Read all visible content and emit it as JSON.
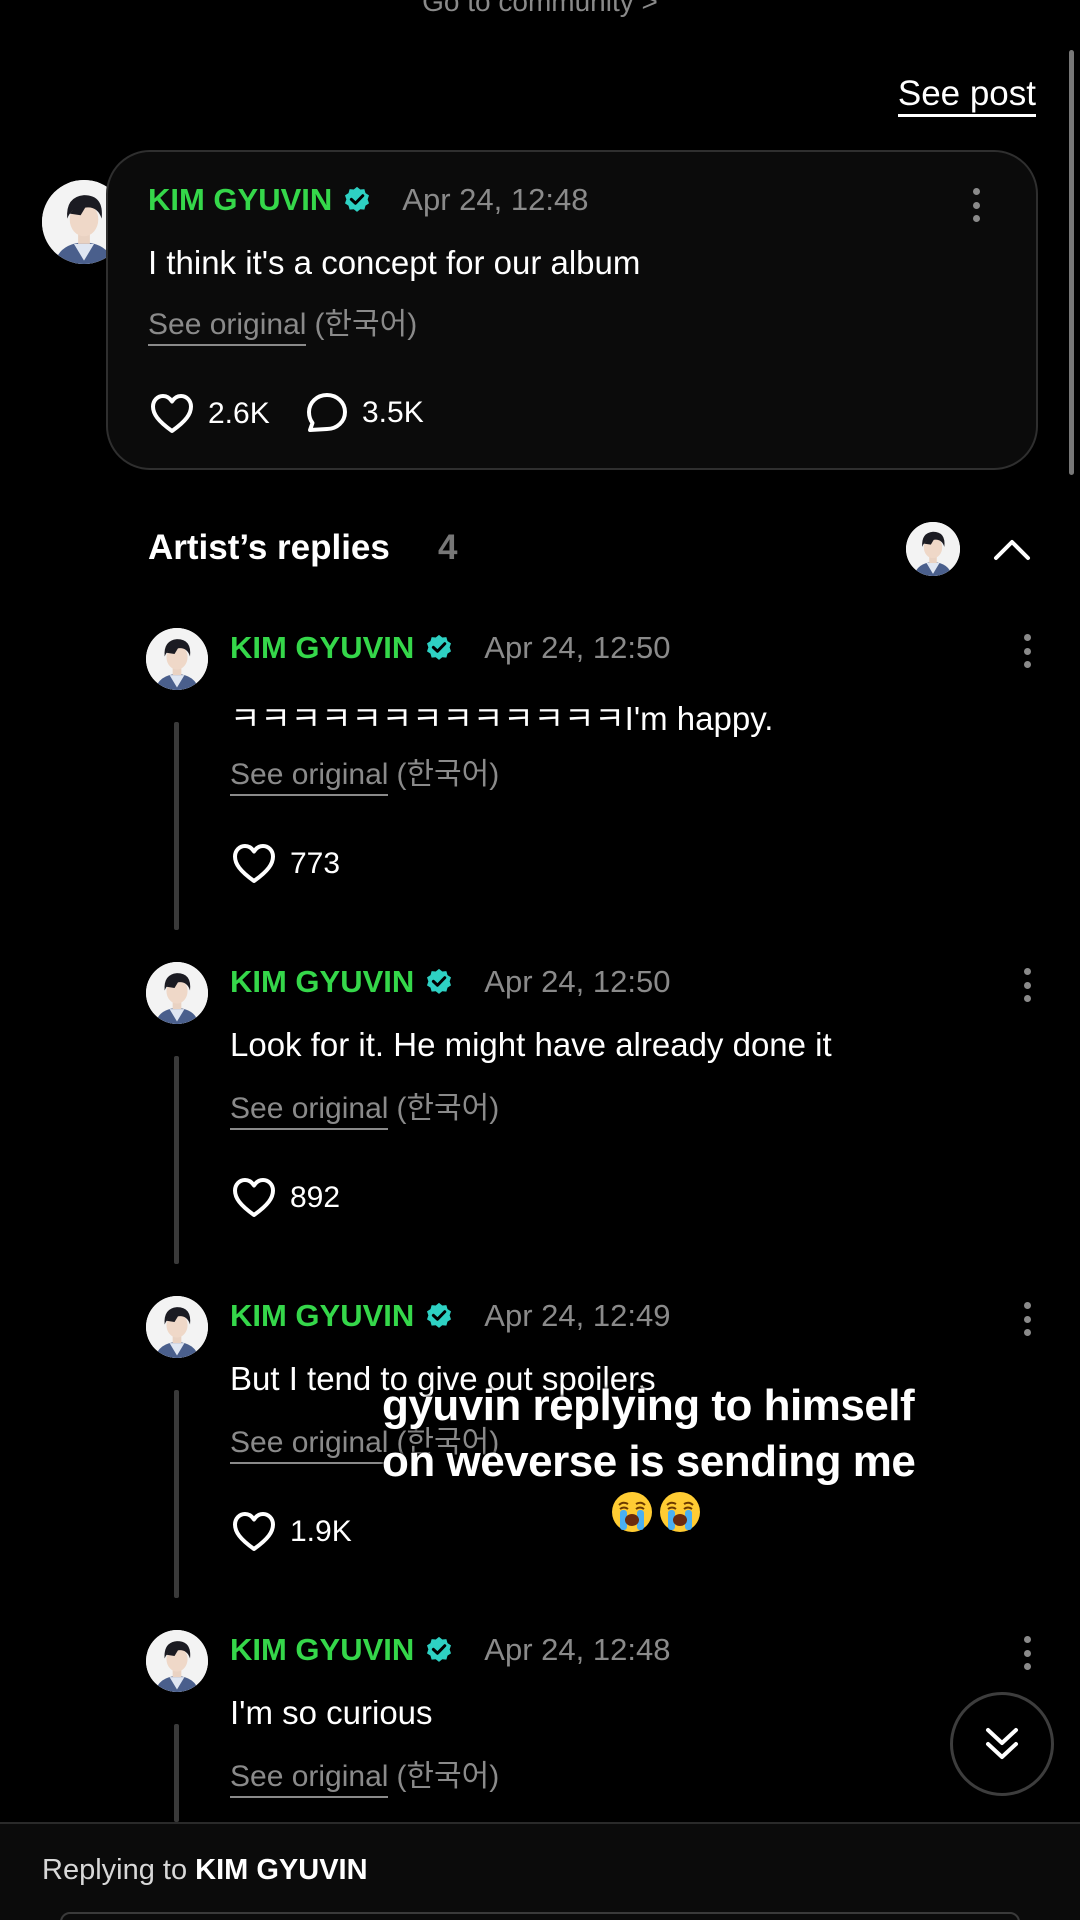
{
  "top": {
    "go_to_community": "Go to community >"
  },
  "header": {
    "see_post": "See post"
  },
  "post": {
    "author": "KIM GYUVIN",
    "time": "Apr 24, 12:48",
    "text": "I think it's a concept for our album",
    "see_original": "See original",
    "lang": "(한국어)",
    "likes": "2.6K",
    "comments": "3.5K"
  },
  "replies_section": {
    "title": "Artist’s replies",
    "count": "4"
  },
  "replies": [
    {
      "author": "KIM GYUVIN",
      "time": "Apr 24, 12:50",
      "text": "ㅋㅋㅋㅋㅋㅋㅋㅋㅋㅋㅋㅋㅋI'm happy.",
      "see_original": "See original",
      "lang": "(한국어)",
      "likes": "773"
    },
    {
      "author": "KIM GYUVIN",
      "time": "Apr 24, 12:50",
      "text": "Look for it. He might have already done it",
      "see_original": "See original",
      "lang": "(한국어)",
      "likes": "892"
    },
    {
      "author": "KIM GYUVIN",
      "time": "Apr 24, 12:49",
      "text": "But I tend to give out spoilers",
      "see_original": "See original",
      "lang": "(한국어)",
      "likes": "1.9K"
    },
    {
      "author": "KIM GYUVIN",
      "time": "Apr 24, 12:48",
      "text": "I'm so curious",
      "see_original": "See original",
      "lang": "(한국어)"
    }
  ],
  "overlay": {
    "line1": "gyuvin replying to himself",
    "line2": "on weverse is sending me"
  },
  "reply_bar": {
    "prefix": "Replying to",
    "name": "KIM GYUVIN"
  },
  "icons": {
    "verified": "verified-badge-icon",
    "like": "heart-icon",
    "comment": "comment-bubble-icon",
    "more": "more-vertical-icon",
    "collapse": "chevron-up-icon",
    "scroll": "double-chevron-down-icon",
    "emoji": "loudly-crying-face-emoji"
  },
  "colors": {
    "author": "#35d74a",
    "verified": "#2ed1c3",
    "muted": "#8a8a8a",
    "background": "#000000"
  }
}
